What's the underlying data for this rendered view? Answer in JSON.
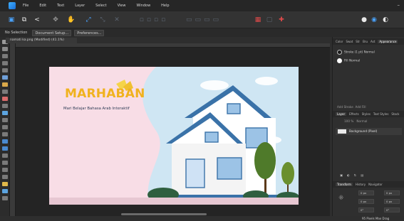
{
  "menu": [
    "File",
    "Edit",
    "Text",
    "Layer",
    "Select",
    "View",
    "Window",
    "Help"
  ],
  "window_controls": "–",
  "contextbar": {
    "selection": "No Selection",
    "document_setup": "Document Setup...",
    "preferences": "Preferences..."
  },
  "document_tab": "namati ka.png (Modified) (41.1%)",
  "panel": {
    "top_tabs": [
      "Color",
      "Swat",
      "Str",
      "Bru",
      "Ast",
      "Appearance"
    ],
    "stroke_label": "Stroke (1 pt)",
    "stroke_mode": "Normal",
    "fill_label": "Fill",
    "fill_mode": "Normal",
    "mid_tabs": [
      "Add Stroke",
      "Add Fill"
    ],
    "layer_tabs": [
      "Layer",
      "Effects",
      "Styles",
      "Text Styles",
      "Stock"
    ],
    "opacity_label": "100 %",
    "blend_label": "Normal",
    "layer_name": "Background",
    "layer_suffix": "(Pixel)",
    "bottom_tabs": [
      "Transform",
      "History",
      "Navigator"
    ],
    "fields": [
      "0 px",
      "0 px",
      "0 px",
      "0 px",
      "0°",
      "0°"
    ]
  },
  "artboard": {
    "title": "MARHABAN",
    "subtitle": "Mari Belajar Bahasa Arab Interaktif",
    "colors": {
      "sky": "#cfe6f3",
      "pink": "#f8dde6",
      "house_wall": "#ffffff",
      "roof": "#3a72a8",
      "tree": "#4f7a2a",
      "grass": "#2f5f3f",
      "title": "#f0b21e"
    }
  },
  "status": "95 Pixels Max Drag"
}
